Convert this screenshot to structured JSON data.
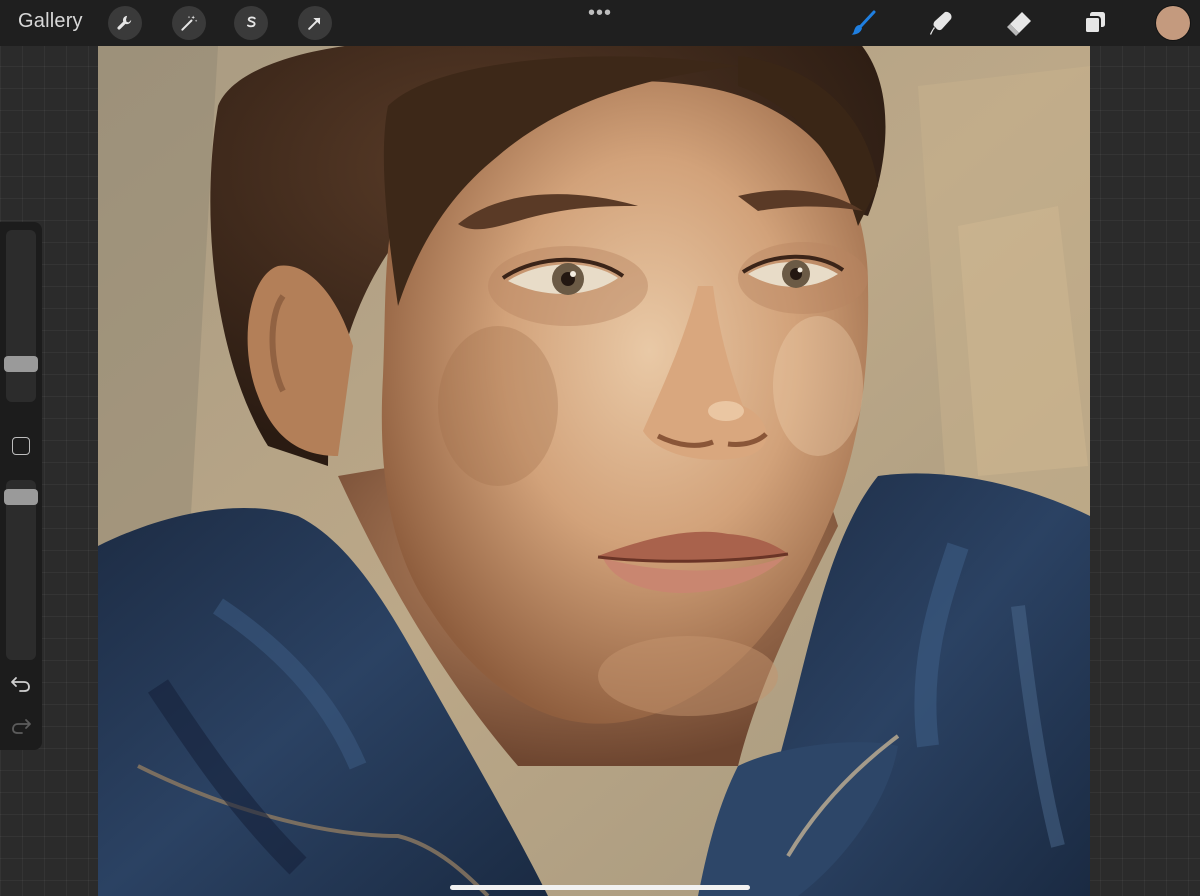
{
  "toolbar": {
    "gallery_label": "Gallery",
    "more_label": "•••",
    "actions_icon": "wrench-icon",
    "adjustments_icon": "magic-wand-icon",
    "selection_icon": "selection-s-icon",
    "transform_icon": "arrow-cursor-icon",
    "brush_icon": "brush-icon",
    "smudge_icon": "smudge-icon",
    "eraser_icon": "eraser-icon",
    "layers_icon": "layers-icon",
    "current_color": "#c49a7e",
    "active_tool_color": "#1f7fe0"
  },
  "sidebar": {
    "brush_size_level": 0.28,
    "opacity_level": 0.95,
    "undo_icon": "undo-icon",
    "redo_icon": "redo-icon",
    "modify_icon": "square-icon"
  }
}
